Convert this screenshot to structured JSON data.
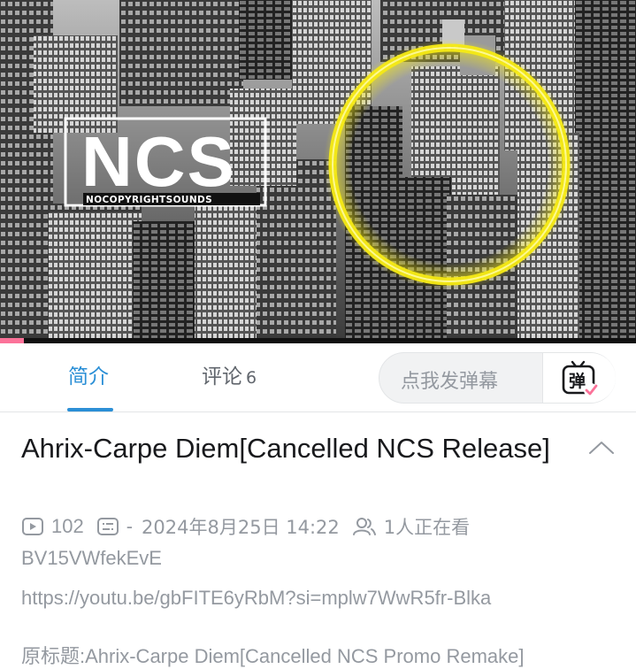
{
  "video": {
    "logo_text": "NCS",
    "logo_subtext": "NOCOPYRIGHTSOUNDS",
    "progress": 0.038,
    "accent_color": "#fb7299"
  },
  "tabs": {
    "intro_label": "简介",
    "comments_label": "评论",
    "comments_count": "6"
  },
  "danmaku": {
    "placeholder": "点我发弹幕",
    "button_glyph": "弹",
    "button_icon": "danmaku-tv-icon"
  },
  "info": {
    "title": "Ahrix-Carpe Diem[Cancelled NCS Release]",
    "views": "102",
    "danmaku_separator": "-",
    "date": "2024年8月25日 14:22",
    "watching": "1人正在看",
    "bvid": "BV15VWfekEvE",
    "description_link": "https://youtu.be/gbFITE6yRbM?si=mplw7WwR5fr-Blka",
    "original_title": "原标题:Ahrix-Carpe Diem[Cancelled NCS Promo Remake]"
  },
  "colors": {
    "tab_active": "#2b8fd6",
    "text_secondary": "#9499a0",
    "ring_yellow": "#f5ea14"
  }
}
